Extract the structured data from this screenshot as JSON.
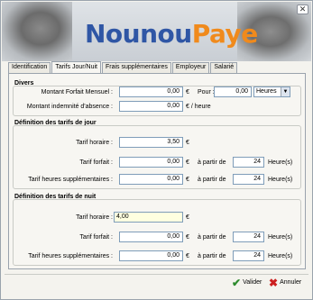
{
  "window": {
    "close_glyph": "✕"
  },
  "banner": {
    "logo_part1": "Nounou",
    "logo_part2": "Paye"
  },
  "tabs": [
    {
      "label": "Identification"
    },
    {
      "label": "Tarifs Jour/Nuit"
    },
    {
      "label": "Frais supplémentaires"
    },
    {
      "label": "Employeur"
    },
    {
      "label": "Salarié"
    }
  ],
  "divers": {
    "title": "Divers",
    "montant_forfait_label": "Montant Forfait Mensuel :",
    "montant_forfait_value": "0,00",
    "montant_forfait_unit": "€",
    "pour_label": "Pour :",
    "pour_value": "0,00",
    "pour_unit_selected": "Heures",
    "indemnite_label": "Montant indemnité d'absence :",
    "indemnite_value": "0,00",
    "indemnite_unit": "€ / heure"
  },
  "jour": {
    "title": "Définition des tarifs de jour",
    "horaire_label": "Tarif horaire :",
    "horaire_value": "3,50",
    "horaire_unit": "€",
    "forfait_label": "Tarif forfait :",
    "forfait_value": "0,00",
    "forfait_unit": "€",
    "forfait_apartir": "à partir de",
    "forfait_hours": "24",
    "forfait_hours_unit": "Heure(s)",
    "supp_label": "Tarif heures supplémentaires :",
    "supp_value": "0,00",
    "supp_unit": "€",
    "supp_apartir": "à partir de",
    "supp_hours": "24",
    "supp_hours_unit": "Heure(s)"
  },
  "nuit": {
    "title": "Définition des tarifs de nuit",
    "horaire_label": "Tarif horaire :",
    "horaire_value": "4,00",
    "horaire_unit": "€",
    "forfait_label": "Tarif forfait :",
    "forfait_value": "0,00",
    "forfait_unit": "€",
    "forfait_apartir": "à partir de",
    "forfait_hours": "24",
    "forfait_hours_unit": "Heure(s)",
    "supp_label": "Tarif heures supplémentaires :",
    "supp_value": "0,00",
    "supp_unit": "€",
    "supp_apartir": "à partir de",
    "supp_hours": "24",
    "supp_hours_unit": "Heure(s)"
  },
  "footer": {
    "valider_label": "Valider",
    "annuler_label": "Annuler",
    "valider_icon": "check-icon",
    "annuler_icon": "cross-icon",
    "valider_color": "#2e8b2e",
    "annuler_color": "#cc1f1f"
  }
}
